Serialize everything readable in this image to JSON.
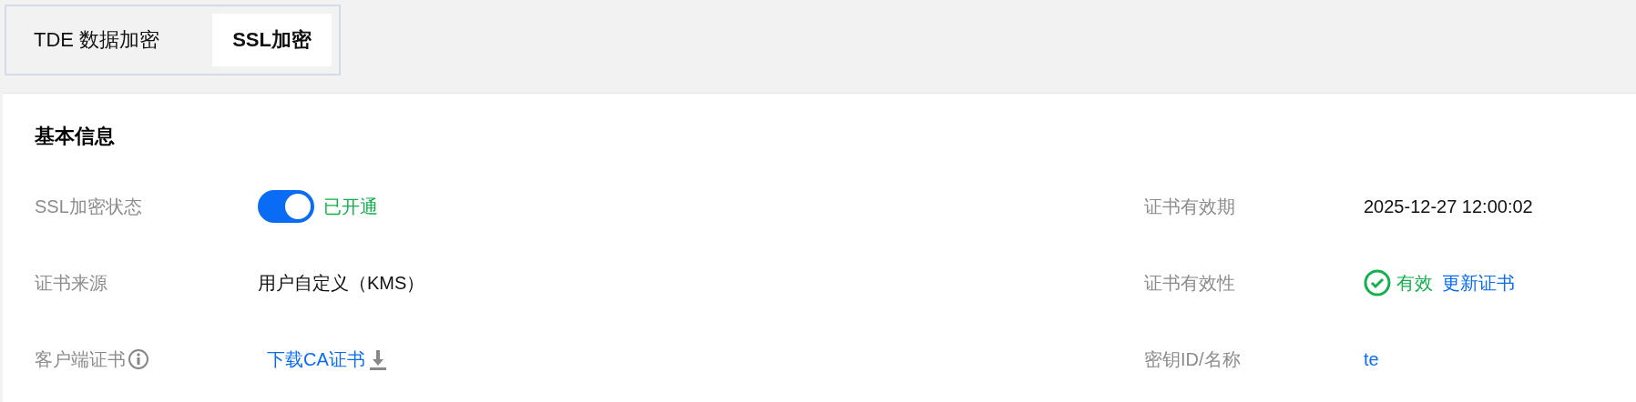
{
  "tabs": [
    {
      "label": "TDE 数据加密",
      "selected": false
    },
    {
      "label": "SSL加密",
      "selected": true
    }
  ],
  "section": {
    "title": "基本信息"
  },
  "left_fields": [
    {
      "kind": "switch",
      "label": "SSL加密状态",
      "on": true,
      "value": "已开通"
    },
    {
      "kind": "text",
      "label": "证书来源",
      "value": "用户自定义（KMS）"
    },
    {
      "kind": "download",
      "label": "客户端证书",
      "info": true,
      "value": "下载CA证书"
    }
  ],
  "right_fields": [
    {
      "kind": "text",
      "label": "证书有效期",
      "value": "2025-12-27 12:00:02"
    },
    {
      "kind": "status",
      "label": "证书有效性",
      "value": "有效",
      "link": "更新证书"
    },
    {
      "kind": "link",
      "label": "密钥ID/名称",
      "value": "te"
    }
  ]
}
